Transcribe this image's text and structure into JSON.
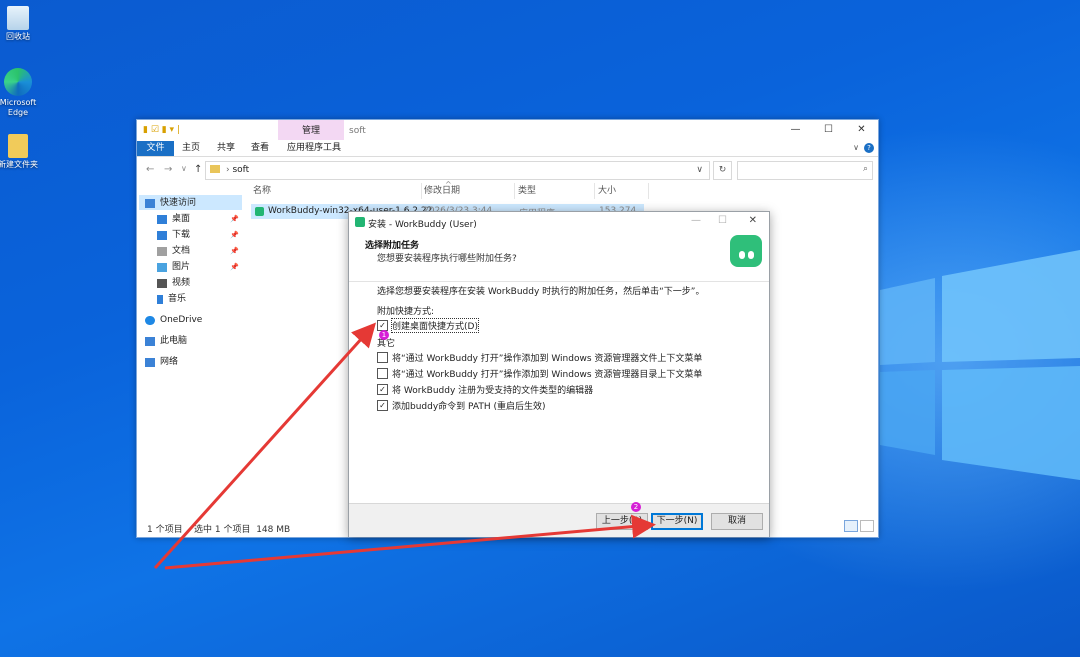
{
  "desktop": {
    "icons": [
      {
        "label": "回收站"
      },
      {
        "label": "Microsoft Edge"
      },
      {
        "label": "新建文件夹"
      }
    ]
  },
  "explorer": {
    "context_tab": "管理",
    "folder_title": "soft",
    "ribbon_tabs": [
      "文件",
      "主页",
      "共享",
      "查看",
      "应用程序工具"
    ],
    "window_controls": [
      "—",
      "☐",
      "✕"
    ],
    "breadcrumb": "soft",
    "address_chevron": "∨",
    "refresh_icon": "↻",
    "search_icon": "⌕",
    "nav_arrows": [
      "←",
      "→",
      "∨",
      "↑"
    ],
    "nav_pane": [
      {
        "label": "快速访问",
        "color": "#3b82d6"
      },
      {
        "label": "桌面",
        "color": "#2f7fd8"
      },
      {
        "label": "下载",
        "color": "#2f7fd8"
      },
      {
        "label": "文档",
        "color": "#a0a0a0"
      },
      {
        "label": "图片",
        "color": "#4aa3e0"
      },
      {
        "label": "视频",
        "color": "#555555"
      },
      {
        "label": "音乐",
        "color": "#2f7fd8"
      },
      {
        "label": "OneDrive",
        "color": "#1e88e5"
      },
      {
        "label": "此电脑",
        "color": "#3b82d6"
      },
      {
        "label": "网络",
        "color": "#3b82d6"
      }
    ],
    "columns": [
      "名称",
      "修改日期",
      "类型",
      "大小"
    ],
    "file": {
      "name": "WorkBuddy-win32-x64-user-1.6.2.22",
      "date": "2026/3/23 3:44",
      "type": "应用程序",
      "size": "153,274 KB"
    },
    "status": "1 个项目    选中 1 个项目  148 MB"
  },
  "installer": {
    "title": "安装 - WorkBuddy (User)",
    "title_controls": [
      "—",
      "☐",
      "✕"
    ],
    "heading": "选择附加任务",
    "subheading": "您想要安装程序执行哪些附加任务?",
    "instruction": "选择您想要安装程序在安装 WorkBuddy 时执行的附加任务，然后单击“下一步”。",
    "group1": "附加快捷方式:",
    "group2": "其它",
    "tasks": [
      {
        "label": "创建桌面快捷方式(D)",
        "checked": true
      },
      {
        "label": "将“通过 WorkBuddy 打开”操作添加到 Windows 资源管理器文件上下文菜单",
        "checked": false
      },
      {
        "label": "将“通过 WorkBuddy 打开”操作添加到 Windows 资源管理器目录上下文菜单",
        "checked": false
      },
      {
        "label": "将 WorkBuddy 注册为受支持的文件类型的编辑器",
        "checked": true
      },
      {
        "label": "添加buddy命令到 PATH (重启后生效)",
        "checked": true
      }
    ],
    "check_mark": "✓",
    "buttons": {
      "back": "上一步(B)",
      "next": "下一步(N)",
      "cancel": "取消"
    }
  },
  "markers": [
    "1",
    "2"
  ],
  "colors": {
    "accent": "#1a6fc5",
    "arrow": "#e53935",
    "marker": "#d61fd6",
    "brand": "#2fbf7a"
  }
}
